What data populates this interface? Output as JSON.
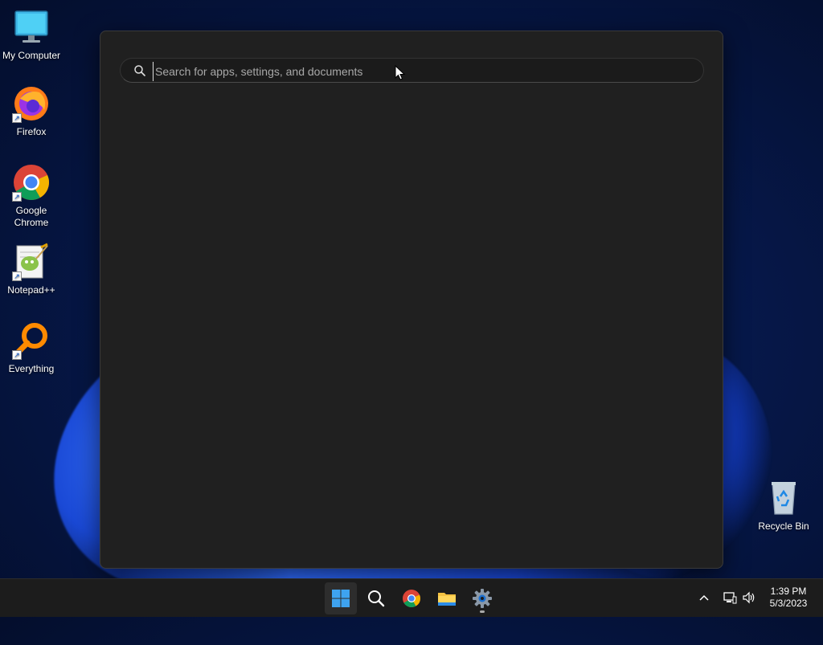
{
  "desktop": {
    "icons": [
      {
        "label": "My Computer"
      },
      {
        "label": "Firefox"
      },
      {
        "label": "Google\nChrome"
      },
      {
        "label": "Notepad++"
      },
      {
        "label": "Everything"
      },
      {
        "label": "Recycle Bin"
      }
    ]
  },
  "search": {
    "placeholder": "Search for apps, settings, and documents",
    "value": ""
  },
  "taskbar": {
    "apps": [
      {
        "icon": "windows-start-icon",
        "active": true
      },
      {
        "icon": "search-icon"
      },
      {
        "icon": "chrome-icon"
      },
      {
        "icon": "file-explorer-icon"
      },
      {
        "icon": "settings-gear-icon",
        "running": true
      }
    ],
    "tray": {
      "icons": [
        "chevron-up-icon",
        "network-icon",
        "volume-icon"
      ]
    },
    "clock": {
      "time": "1:39 PM",
      "date": "5/3/2023"
    }
  },
  "colors": {
    "panel_bg": "#202020",
    "taskbar_bg": "#1c1c1c",
    "accent": "#2b8ce8"
  }
}
